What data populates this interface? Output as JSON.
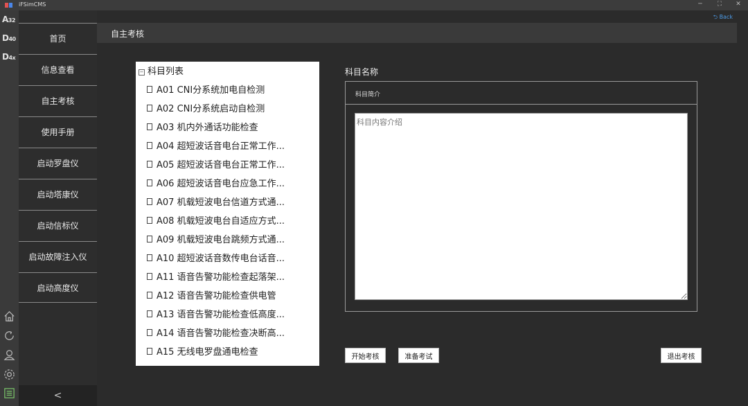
{
  "app": {
    "title": "iFSimCMS",
    "back_label": "Back"
  },
  "rail": {
    "codes": [
      {
        "main": "A",
        "sub": "32"
      },
      {
        "main": "D",
        "sub": "40"
      },
      {
        "main": "D",
        "sub": "4x"
      }
    ]
  },
  "menu": {
    "items": [
      "首页",
      "信息查看",
      "自主考核",
      "使用手册",
      "启动罗盘仪",
      "启动塔康仪",
      "启动信标仪",
      "启动故障注入仪",
      "启动高度仪"
    ],
    "collapse": "<"
  },
  "header": {
    "title": "自主考核"
  },
  "tree": {
    "root": "科目列表",
    "items": [
      "A01 CNI分系统加电自检测",
      "A02 CNI分系统启动自检测",
      "A03 机内外通话功能检查",
      "A04 超短波话音电台正常工作...",
      "A05 超短波话音电台正常工作...",
      "A06 超短波话音电台应急工作...",
      "A07 机载短波电台信道方式通...",
      "A08 机载短波电台自适应方式...",
      "A09 机载短波电台跳频方式通...",
      "A10 超短波话音数传电台话音...",
      "A11 语音告警功能检查起落架...",
      "A12 语音告警功能检查供电管",
      "A13 语音告警功能检查低高度...",
      "A14 语音告警功能检查决断高...",
      "A15 无线电罗盘通电检查"
    ]
  },
  "detail": {
    "name_label": "科目名称",
    "intro_label": "科目简介",
    "content_placeholder": "科目内容介绍"
  },
  "buttons": {
    "start": "开始考核",
    "prepare": "准备考试",
    "exit": "退出考核"
  }
}
